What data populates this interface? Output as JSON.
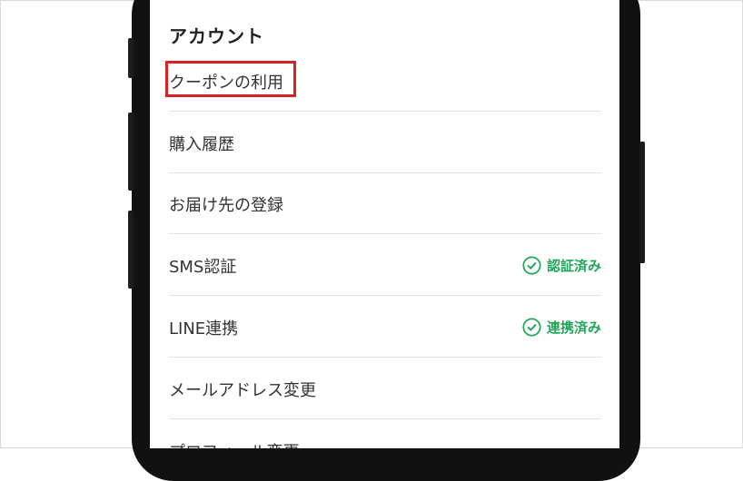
{
  "section": {
    "title": "アカウント"
  },
  "menu": {
    "items": [
      {
        "label": "クーポンの利用"
      },
      {
        "label": "購入履歴"
      },
      {
        "label": "お届け先の登録"
      },
      {
        "label": "SMS認証",
        "status": "認証済み"
      },
      {
        "label": "LINE連携",
        "status": "連携済み"
      },
      {
        "label": "メールアドレス変更"
      },
      {
        "label": "プロフィール変更"
      }
    ]
  },
  "colors": {
    "status_green": "#23a55a",
    "highlight_red": "#d62128",
    "phone_frame": "#111111"
  },
  "icons": {
    "status": "check-circle-icon"
  }
}
